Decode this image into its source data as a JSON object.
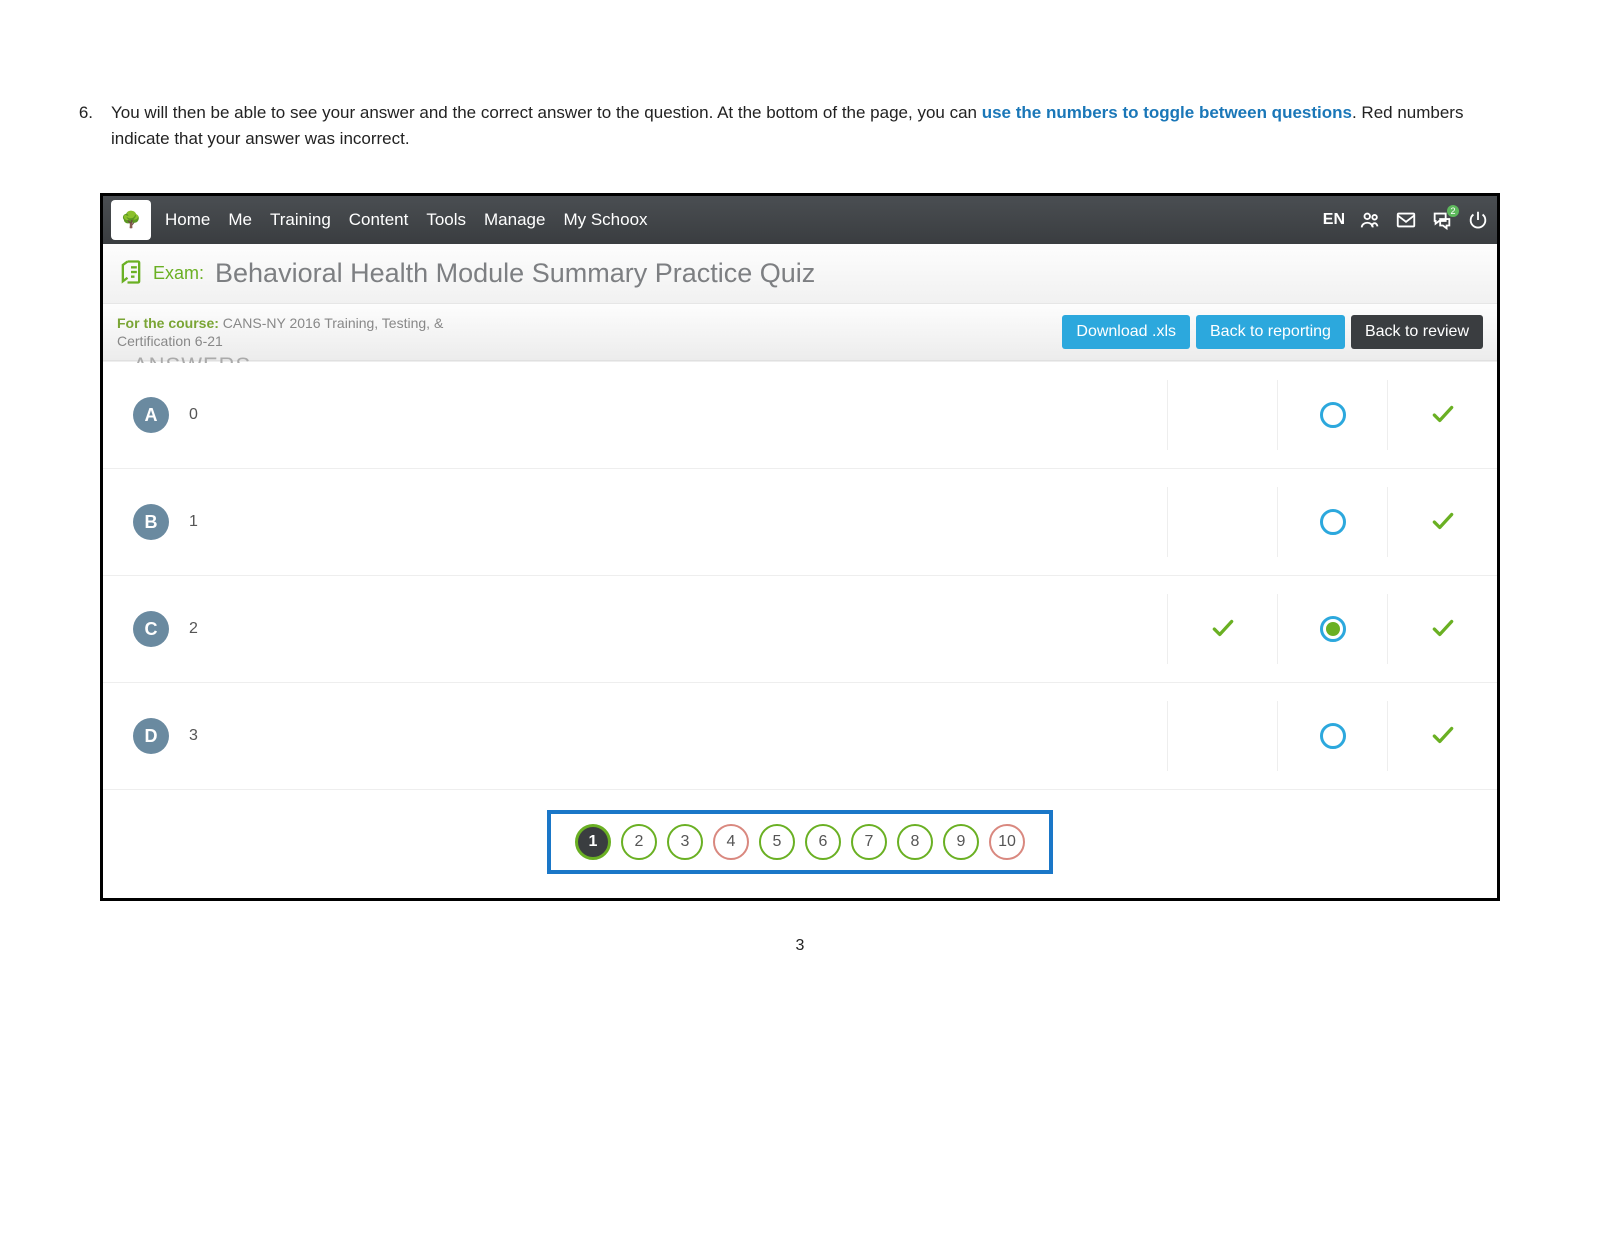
{
  "instruction": {
    "number": "6.",
    "text_before": "You will then be able to see your answer and the correct answer to the question.  At the bottom of the page, you can ",
    "highlight": "use the numbers to toggle between questions",
    "text_after": ". Red numbers indicate that your answer was incorrect."
  },
  "nav": {
    "items": [
      "Home",
      "Me",
      "Training",
      "Content",
      "Tools",
      "Manage",
      "My Schoox"
    ],
    "lang": "EN",
    "msg_badge": "2"
  },
  "exam": {
    "label": "Exam:",
    "title": "Behavioral Health Module Summary Practice Quiz"
  },
  "course": {
    "for_label": "For the course:",
    "name": "CANS-NY 2016 Training, Testing, & Certification 6-21"
  },
  "buttons": {
    "download": "Download .xls",
    "reporting": "Back to reporting",
    "review": "Back to review"
  },
  "answers": [
    {
      "letter": "A",
      "value": "0",
      "your_check": false,
      "selected": false,
      "all_check": true
    },
    {
      "letter": "B",
      "value": "1",
      "your_check": false,
      "selected": false,
      "all_check": true
    },
    {
      "letter": "C",
      "value": "2",
      "your_check": true,
      "selected": true,
      "all_check": true
    },
    {
      "letter": "D",
      "value": "3",
      "your_check": false,
      "selected": false,
      "all_check": true
    }
  ],
  "pager": [
    {
      "n": "1",
      "state": "active"
    },
    {
      "n": "2",
      "state": "green"
    },
    {
      "n": "3",
      "state": "green"
    },
    {
      "n": "4",
      "state": "red"
    },
    {
      "n": "5",
      "state": "green"
    },
    {
      "n": "6",
      "state": "green"
    },
    {
      "n": "7",
      "state": "green"
    },
    {
      "n": "8",
      "state": "green"
    },
    {
      "n": "9",
      "state": "green"
    },
    {
      "n": "10",
      "state": "red"
    }
  ],
  "page_number": "3"
}
